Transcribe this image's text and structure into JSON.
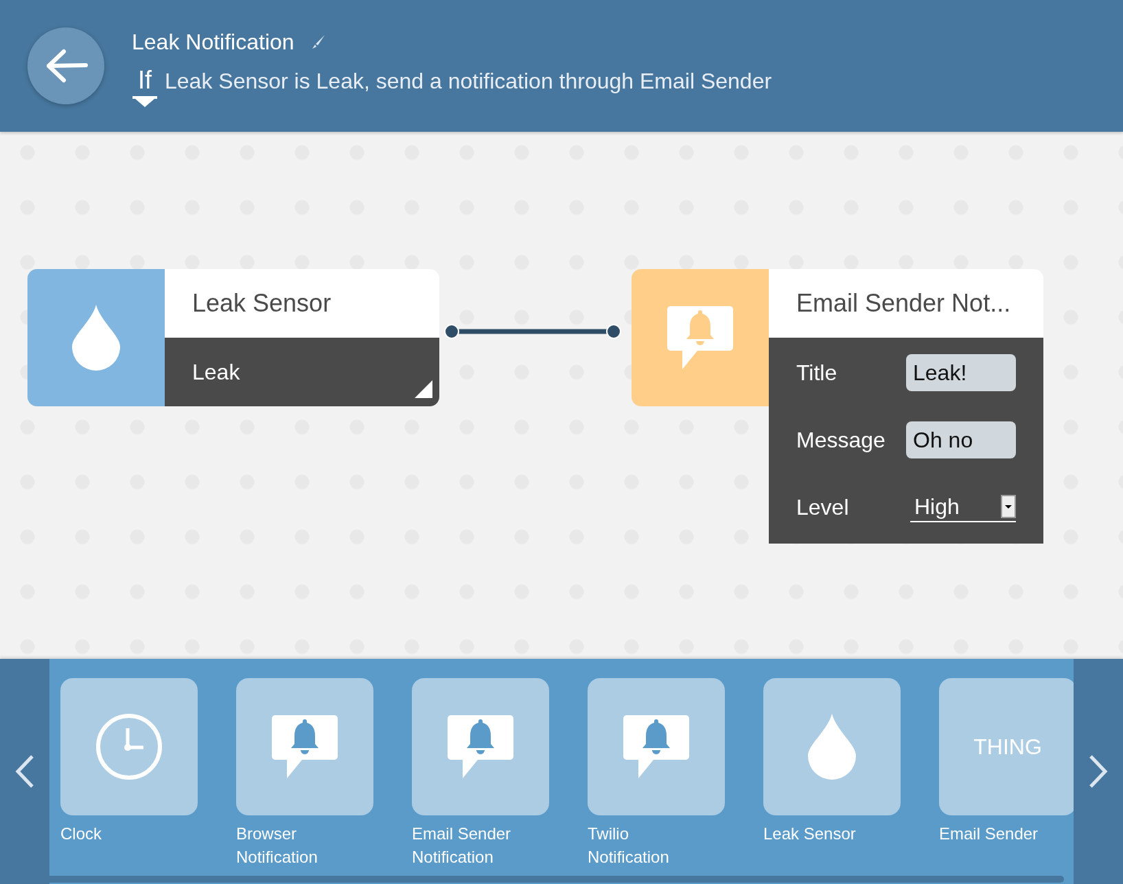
{
  "header": {
    "title": "Leak Notification",
    "condition_keyword": "If",
    "condition": "Leak Sensor is Leak, send a notification through Email Sender"
  },
  "nodes": [
    {
      "kind": "drop",
      "title": "Leak Sensor",
      "value": "Leak"
    },
    {
      "kind": "bell",
      "title": "Email Sender Not...",
      "fields": [
        {
          "kind": "input",
          "label": "Title",
          "value": "Leak!"
        },
        {
          "kind": "input",
          "label": "Message",
          "value": "Oh no"
        },
        {
          "kind": "select",
          "label": "Level",
          "value": "High"
        }
      ]
    }
  ],
  "palette": [
    {
      "kind": "clock",
      "label": "Clock"
    },
    {
      "kind": "bell",
      "label": "Browser Notification"
    },
    {
      "kind": "bell",
      "label": "Email Sender Notification"
    },
    {
      "kind": "bell",
      "label": "Twilio Notification"
    },
    {
      "kind": "drop",
      "label": "Leak Sensor"
    },
    {
      "kind": "text",
      "icon_text": "THING",
      "label": "Email Sender"
    }
  ]
}
